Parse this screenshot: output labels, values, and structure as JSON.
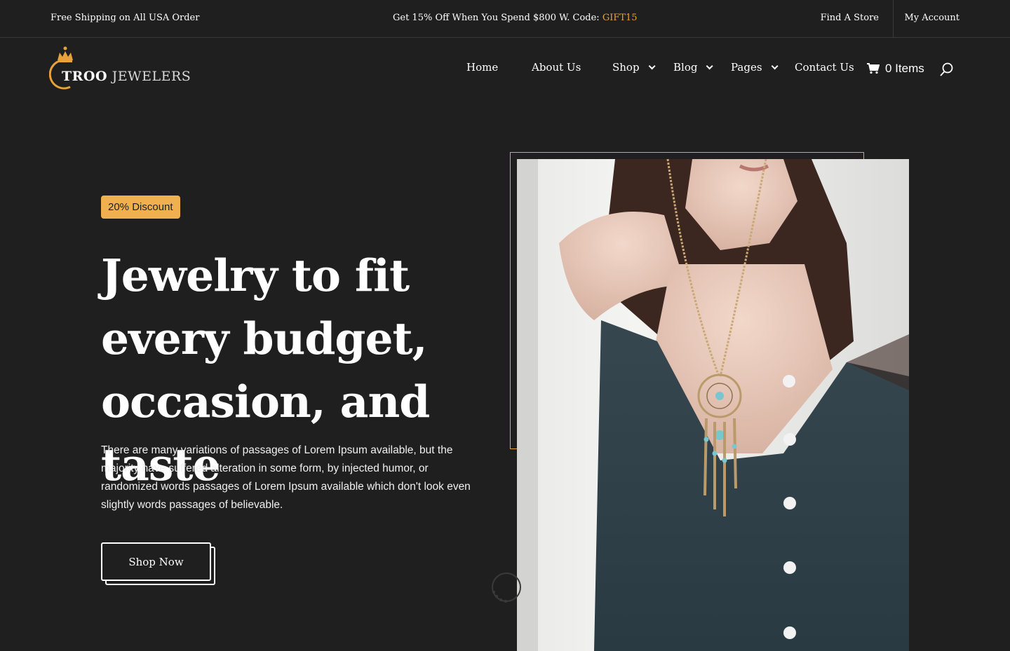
{
  "topbar": {
    "shipping_text": "Free Shipping on All USA Order",
    "promo_text": "Get 15% Off When You Spend $800 W. Code: ",
    "promo_code": "GIFT15",
    "find_store": "Find A Store",
    "my_account": "My Account"
  },
  "logo": {
    "brand_bold": "TROO",
    "brand_rest": " JEWELERS",
    "icon": "ring-crown-icon"
  },
  "nav": {
    "items": [
      {
        "label": "Home",
        "dropdown": false
      },
      {
        "label": "About Us",
        "dropdown": false
      },
      {
        "label": "Shop",
        "dropdown": true
      },
      {
        "label": "Blog",
        "dropdown": true
      },
      {
        "label": "Pages",
        "dropdown": true
      },
      {
        "label": "Contact Us",
        "dropdown": false
      }
    ],
    "cart_label": "0 Items",
    "cart_icon": "cart-icon",
    "search_icon": "search-icon"
  },
  "hero": {
    "badge": "20% Discount",
    "title": "Jewelry to fit every budget, occasion, and taste",
    "text": "There are many variations of passages of Lorem Ipsum available, but the majority have suffered alteration in some form, by injected humor, or randomized words passages of Lorem Ipsum available which don't look even slightly words passages of believable.",
    "button": "Shop Now"
  },
  "colors": {
    "background": "#1f1f1f",
    "accent": "#e8a23a",
    "badge": "#f0b04f"
  }
}
